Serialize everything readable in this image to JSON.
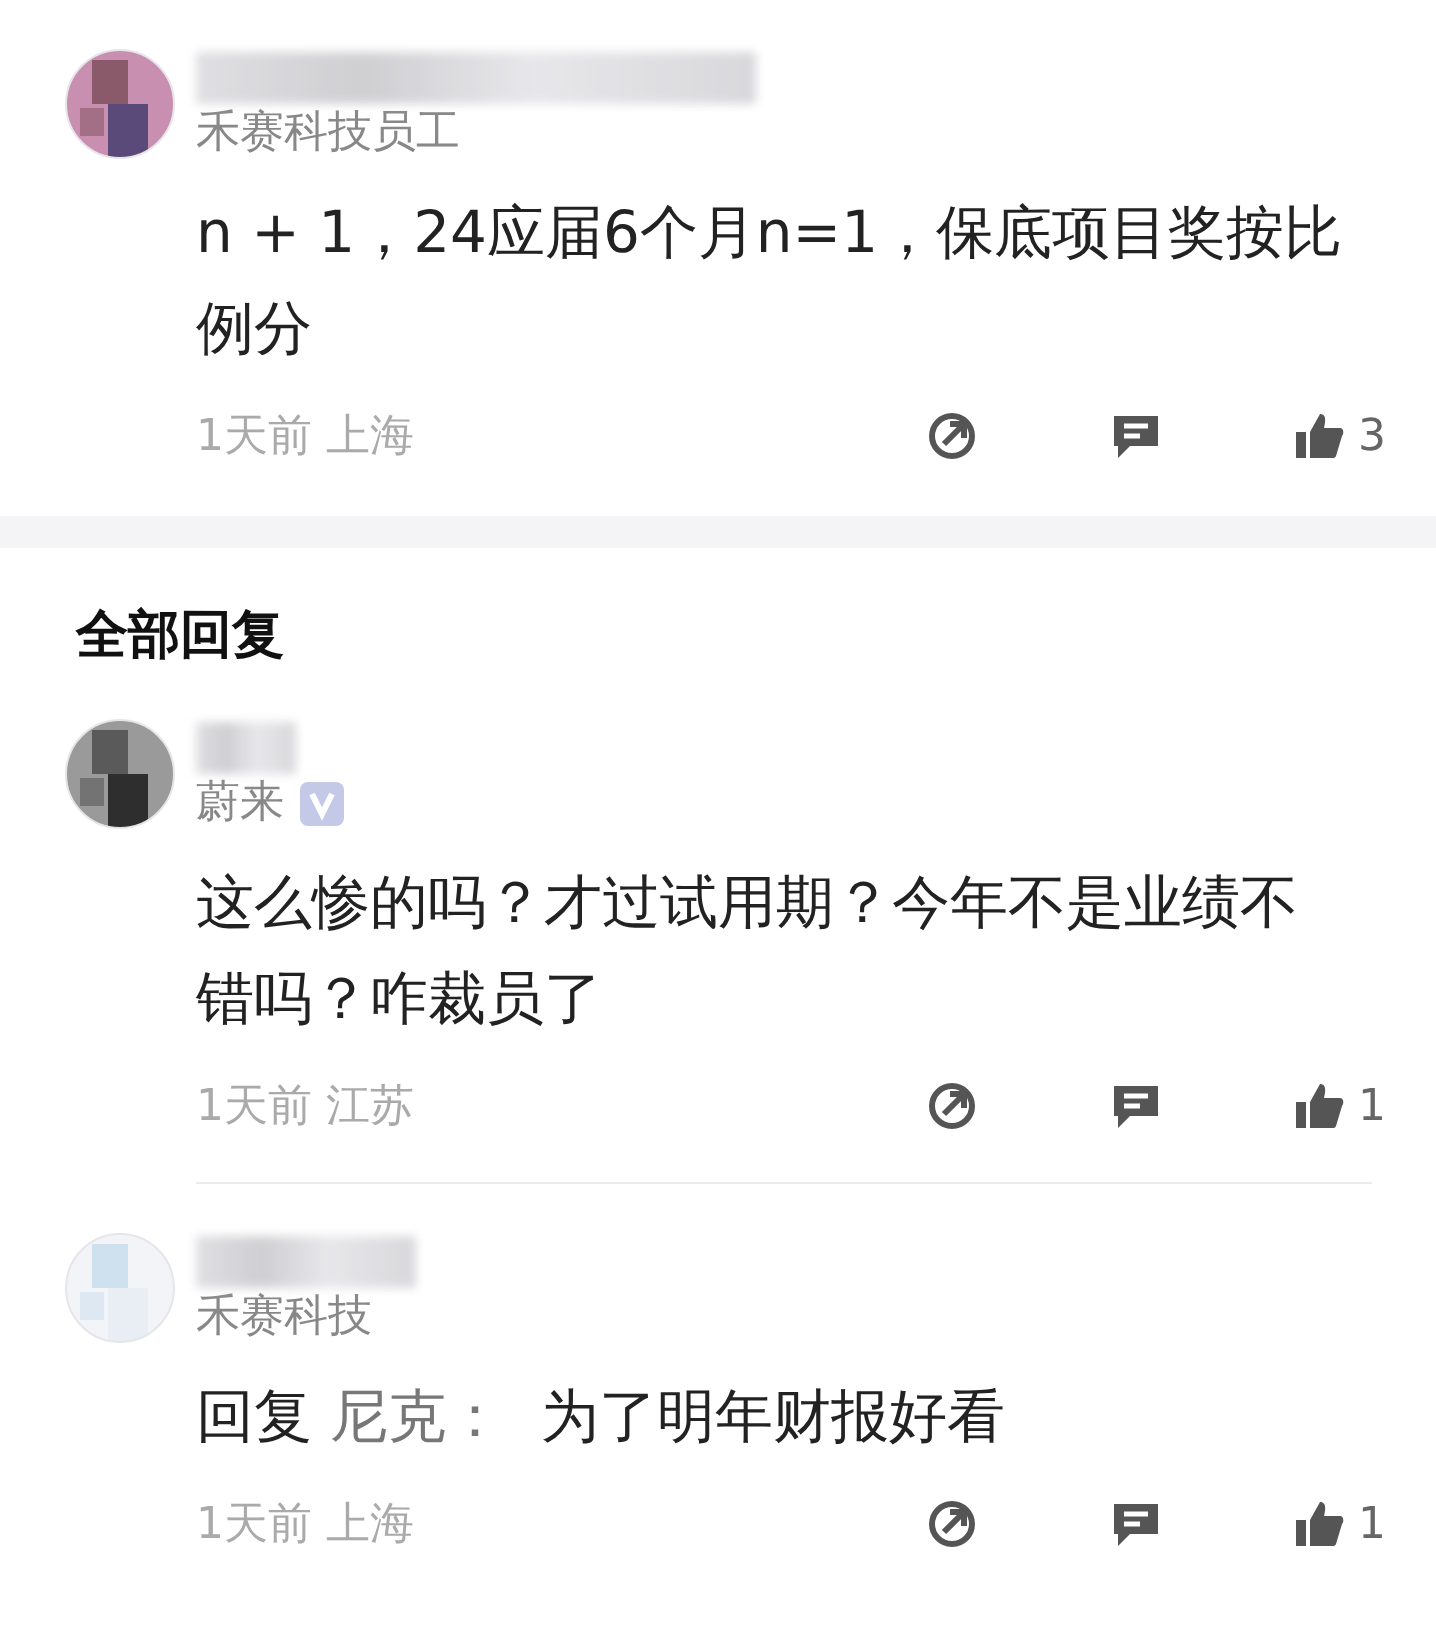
{
  "top_comment": {
    "affiliation": "禾赛科技员工",
    "verified": false,
    "text": "n + 1，24应届6个月n=1，保底项目奖按比例分",
    "time": "1天前",
    "location": "上海",
    "likes": "3"
  },
  "section_title": "全部回复",
  "replies": [
    {
      "affiliation": "蔚来",
      "verified": true,
      "nested": false,
      "text": "这么惨的吗？才过试用期？今年不是业绩不错吗？咋裁员了",
      "time": "1天前",
      "location": "江苏",
      "likes": "1"
    },
    {
      "affiliation": "禾赛科技",
      "verified": false,
      "nested": true,
      "reply_label": "回复",
      "reply_to": "尼克：",
      "text": "为了明年财报好看",
      "time": "1天前",
      "location": "上海",
      "likes": "1"
    }
  ]
}
